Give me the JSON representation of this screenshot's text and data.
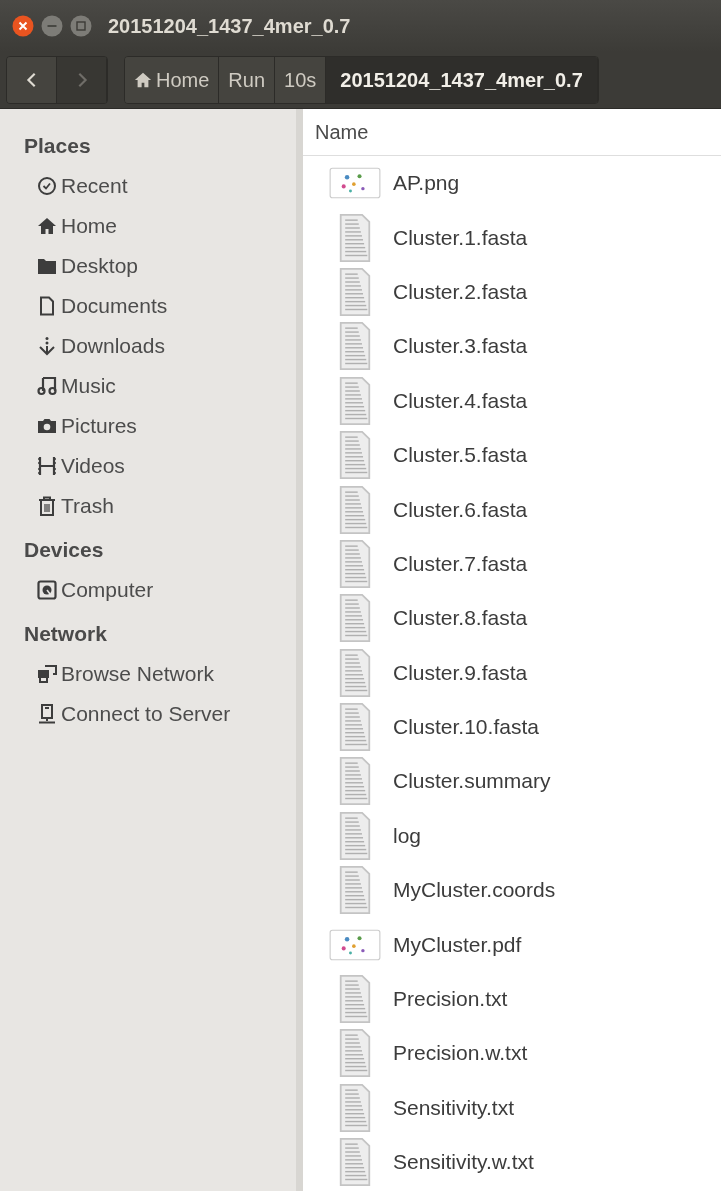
{
  "window": {
    "title": "20151204_1437_4mer_0.7"
  },
  "toolbar": {
    "nav_buttons": [
      {
        "kind": "back",
        "disabled": false
      },
      {
        "kind": "forward",
        "disabled": true
      }
    ],
    "breadcrumbs": [
      {
        "label": "Home",
        "kind": "home",
        "selected": false
      },
      {
        "label": "Run",
        "kind": "plain",
        "selected": false
      },
      {
        "label": "10s",
        "kind": "plain",
        "selected": false
      },
      {
        "label": "20151204_1437_4mer_0.7",
        "kind": "plain",
        "selected": true
      }
    ]
  },
  "sidebar": {
    "sections": [
      {
        "title": "Places",
        "items": [
          {
            "label": "Recent",
            "kind": "recent"
          },
          {
            "label": "Home",
            "kind": "home"
          },
          {
            "label": "Desktop",
            "kind": "folder"
          },
          {
            "label": "Documents",
            "kind": "document"
          },
          {
            "label": "Downloads",
            "kind": "download"
          },
          {
            "label": "Music",
            "kind": "music"
          },
          {
            "label": "Pictures",
            "kind": "camera"
          },
          {
            "label": "Videos",
            "kind": "film"
          },
          {
            "label": "Trash",
            "kind": "trash"
          }
        ]
      },
      {
        "title": "Devices",
        "items": [
          {
            "label": "Computer",
            "kind": "drive"
          }
        ]
      },
      {
        "title": "Network",
        "items": [
          {
            "label": "Browse Network",
            "kind": "network"
          },
          {
            "label": "Connect to Server",
            "kind": "server"
          }
        ]
      }
    ]
  },
  "file_list": {
    "columns": [
      "Name"
    ],
    "rows": [
      {
        "name": "AP.png",
        "kind": "image"
      },
      {
        "name": "Cluster.1.fasta",
        "kind": "text"
      },
      {
        "name": "Cluster.2.fasta",
        "kind": "text"
      },
      {
        "name": "Cluster.3.fasta",
        "kind": "text"
      },
      {
        "name": "Cluster.4.fasta",
        "kind": "text"
      },
      {
        "name": "Cluster.5.fasta",
        "kind": "text"
      },
      {
        "name": "Cluster.6.fasta",
        "kind": "text"
      },
      {
        "name": "Cluster.7.fasta",
        "kind": "text"
      },
      {
        "name": "Cluster.8.fasta",
        "kind": "text"
      },
      {
        "name": "Cluster.9.fasta",
        "kind": "text"
      },
      {
        "name": "Cluster.10.fasta",
        "kind": "text"
      },
      {
        "name": "Cluster.summary",
        "kind": "text"
      },
      {
        "name": "log",
        "kind": "text"
      },
      {
        "name": "MyCluster.coords",
        "kind": "text"
      },
      {
        "name": "MyCluster.pdf",
        "kind": "image"
      },
      {
        "name": "Precision.txt",
        "kind": "text"
      },
      {
        "name": "Precision.w.txt",
        "kind": "text"
      },
      {
        "name": "Sensitivity.txt",
        "kind": "text"
      },
      {
        "name": "Sensitivity.w.txt",
        "kind": "text"
      }
    ]
  }
}
